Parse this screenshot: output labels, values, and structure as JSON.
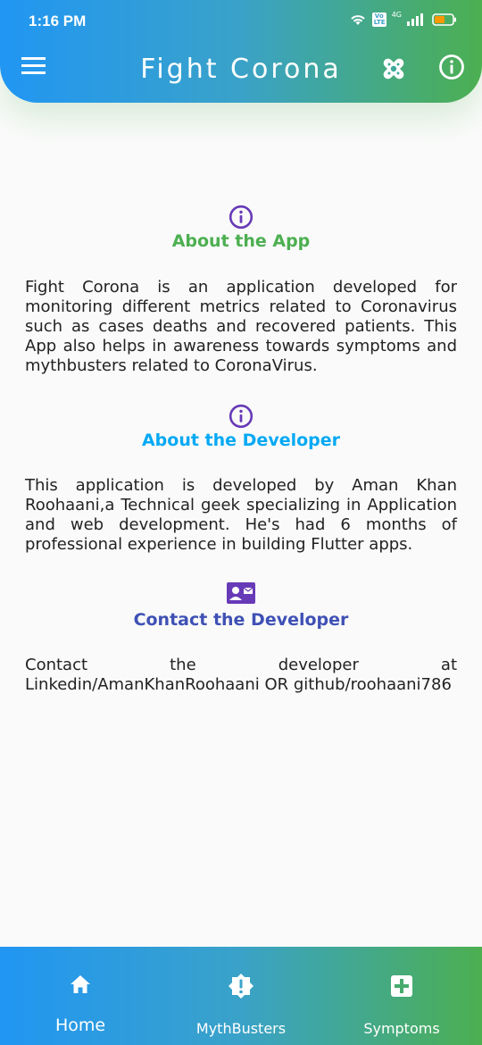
{
  "status_bar": {
    "time": "1:16 PM",
    "network": "4G",
    "volte": "Vo LTE"
  },
  "app_bar": {
    "title": "Fight Corona"
  },
  "sections": {
    "about_app": {
      "title": "About the App",
      "body": "Fight Corona is an application developed for monitoring different metrics related to Coronavirus such as cases deaths and recovered patients. This App also helps in awareness towards symptoms and mythbusters related to CoronaVirus."
    },
    "about_developer": {
      "title": "About the Developer",
      "body": "This application is developed by Aman Khan Roohaani,a Technical geek specializing in Application and web development. He's had 6 months of professional experience in building Flutter apps."
    },
    "contact": {
      "title": "Contact the Developer",
      "body": "Contact the developer at Linkedin/AmanKhanRoohaani OR github/roohaani786"
    }
  },
  "bottom_nav": {
    "items": [
      {
        "label": "Home",
        "icon": "home-icon"
      },
      {
        "label": "MythBusters",
        "icon": "alert-badge-icon"
      },
      {
        "label": "Symptoms",
        "icon": "medical-plus-icon"
      }
    ]
  },
  "colors": {
    "gradient_start": "#2196f3",
    "gradient_end": "#4caf50",
    "about_app_title": "#4caf50",
    "about_developer_title": "#03a9f4",
    "contact_title": "#3f51b5",
    "section_icon": "#673ab7"
  }
}
